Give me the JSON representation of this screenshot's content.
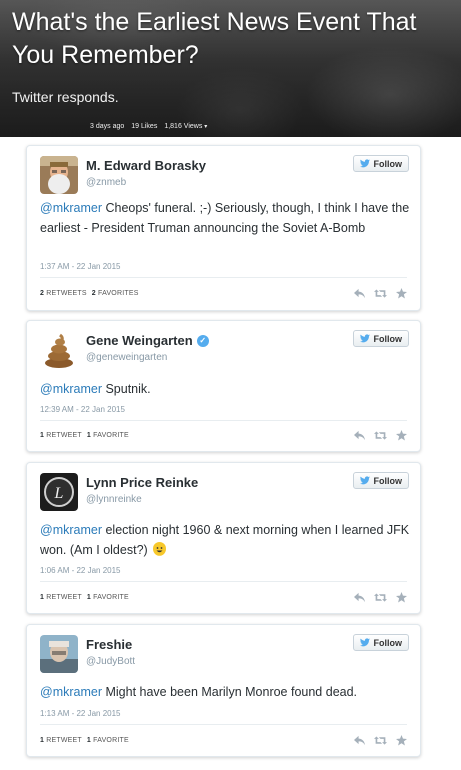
{
  "header": {
    "title": "What's the Earliest News Event That You Remember?",
    "subtitle": "Twitter responds.",
    "posted": "3 days ago",
    "likes": "19 Likes",
    "views": "1,816 Views",
    "views_caret": "▾"
  },
  "follow_label": "Follow",
  "tweets": [
    {
      "name": "M. Edward Borasky",
      "handle": "@znmeb",
      "verified": false,
      "mention": "@mkramer",
      "text": " Cheops' funeral. ;-) Seriously, though, I think I have the earliest - President Truman announcing the Soviet A-Bomb",
      "timestamp": "1:37 AM - 22 Jan 2015",
      "retweets": "2",
      "retweets_label": "RETWEETS",
      "favorites": "2",
      "favorites_label": "FAVORITES"
    },
    {
      "name": "Gene Weingarten",
      "handle": "@geneweingarten",
      "verified": true,
      "mention": "@mkramer",
      "text": " Sputnik.",
      "timestamp": "12:39 AM - 22 Jan 2015",
      "retweets": "1",
      "retweets_label": "RETWEET",
      "favorites": "1",
      "favorites_label": "FAVORITE"
    },
    {
      "name": "Lynn Price Reinke",
      "handle": "@lynnreinke",
      "verified": false,
      "mention": "@mkramer",
      "text": " election night 1960 & next morning when I learned JFK won. (Am I oldest?)",
      "timestamp": "1:06 AM - 22 Jan 2015",
      "retweets": "1",
      "retweets_label": "RETWEET",
      "favorites": "1",
      "favorites_label": "FAVORITE"
    },
    {
      "name": "Freshie",
      "handle": "@JudyBott",
      "verified": false,
      "mention": "@mkramer",
      "text": " Might have been Marilyn Monroe found dead.",
      "timestamp": "1:13 AM - 22 Jan 2015",
      "retweets": "1",
      "retweets_label": "RETWEET",
      "favorites": "1",
      "favorites_label": "FAVORITE"
    }
  ],
  "colors": {
    "link": "#2b7bb9",
    "verified": "#55acee",
    "muted": "#8899a6"
  }
}
